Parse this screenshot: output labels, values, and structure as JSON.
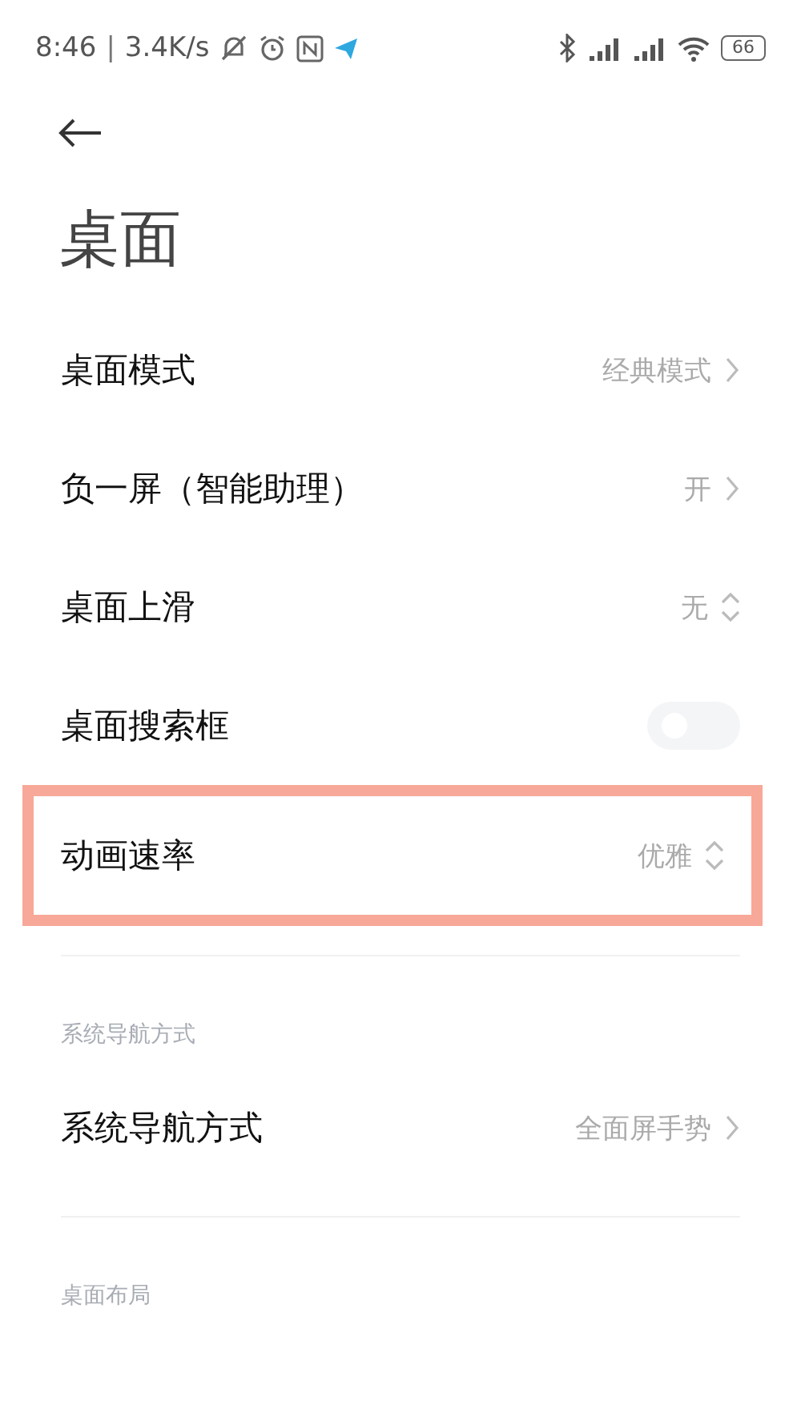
{
  "status_bar": {
    "time": "8:46",
    "separator": "|",
    "speed": "3.4K/s",
    "battery": "66"
  },
  "title": "桌面",
  "sections": [
    {
      "items": [
        {
          "kind": "link",
          "label": "桌面模式",
          "value": "经典模式",
          "highlighted": false
        },
        {
          "kind": "link",
          "label": "负一屏（智能助理）",
          "value": "开",
          "highlighted": false
        },
        {
          "kind": "select",
          "label": "桌面上滑",
          "value": "无",
          "highlighted": false
        },
        {
          "kind": "toggle",
          "label": "桌面搜索框",
          "on": false,
          "highlighted": false
        },
        {
          "kind": "select",
          "label": "动画速率",
          "value": "优雅",
          "highlighted": true
        }
      ]
    },
    {
      "header": "系统导航方式",
      "items": [
        {
          "kind": "link",
          "label": "系统导航方式",
          "value": "全面屏手势",
          "highlighted": false
        }
      ]
    },
    {
      "header": "桌面布局"
    }
  ]
}
